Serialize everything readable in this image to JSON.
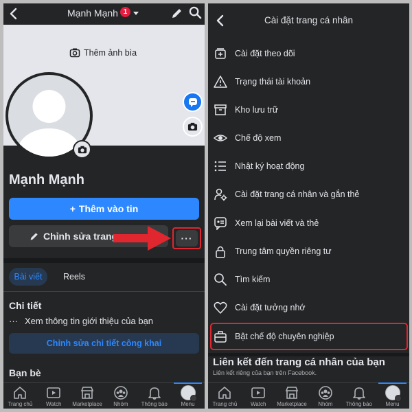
{
  "left": {
    "header": {
      "title": "Mạnh Mạnh",
      "badge": "1"
    },
    "cover": {
      "add_cover_label": "Thêm ảnh bìa"
    },
    "profile": {
      "name": "Mạnh Mạnh"
    },
    "buttons": {
      "add_story": "Thêm vào tin",
      "edit_profile": "Chỉnh sửa trang",
      "more": "···"
    },
    "tabs": [
      {
        "label": "Bài viết",
        "active": true
      },
      {
        "label": "Reels",
        "active": false
      }
    ],
    "details": {
      "heading": "Chi tiết",
      "see_more": "Xem thông tin giới thiệu của bạn",
      "edit_details": "Chỉnh sửa chi tiết công khai"
    },
    "friends": {
      "heading": "Bạn bè",
      "count": "··· ···· ···"
    },
    "tabbar": [
      {
        "label": "Trang chủ",
        "icon": "home-icon"
      },
      {
        "label": "Watch",
        "icon": "watch-icon"
      },
      {
        "label": "Marketplace",
        "icon": "marketplace-icon"
      },
      {
        "label": "Nhóm",
        "icon": "groups-icon"
      },
      {
        "label": "Thông báo",
        "icon": "bell-icon"
      },
      {
        "label": "Menu",
        "icon": "avatar-icon",
        "active": true
      }
    ]
  },
  "right": {
    "header": {
      "title": "Cài đặt trang cá nhân"
    },
    "menu": [
      {
        "label": "Cài đặt theo dõi",
        "icon": "follow-settings-icon"
      },
      {
        "label": "Trạng thái tài khoản",
        "icon": "warning-icon"
      },
      {
        "label": "Kho lưu trữ",
        "icon": "archive-icon"
      },
      {
        "label": "Chế độ xem",
        "icon": "eye-icon"
      },
      {
        "label": "Nhật ký hoạt động",
        "icon": "list-icon"
      },
      {
        "label": "Cài đặt trang cá nhân và gắn thẻ",
        "icon": "profile-gear-icon"
      },
      {
        "label": "Xem lại bài viết và thẻ",
        "icon": "review-icon"
      },
      {
        "label": "Trung tâm quyền riêng tư",
        "icon": "lock-icon"
      },
      {
        "label": "Tìm kiếm",
        "icon": "search-icon"
      },
      {
        "label": "Cài đặt tưởng nhớ",
        "icon": "heart-icon"
      },
      {
        "label": "Bật chế độ chuyên nghiệp",
        "icon": "briefcase-icon",
        "highlighted": true
      }
    ],
    "link_section": {
      "heading": "Liên kết đến trang cá nhân của bạn",
      "sub": "Liên kết riêng của bạn trên Facebook."
    },
    "tabbar": [
      {
        "label": "Trang chủ",
        "icon": "home-icon"
      },
      {
        "label": "Watch",
        "icon": "watch-icon"
      },
      {
        "label": "Marketplace",
        "icon": "marketplace-icon"
      },
      {
        "label": "Nhóm",
        "icon": "groups-icon"
      },
      {
        "label": "Thông báo",
        "icon": "bell-icon"
      },
      {
        "label": "Menu",
        "icon": "avatar-icon",
        "active": true
      }
    ]
  },
  "colors": {
    "accent": "#2d88ff",
    "highlight": "#e0262f",
    "panel": "#242526",
    "badge": "#e41e3f"
  }
}
